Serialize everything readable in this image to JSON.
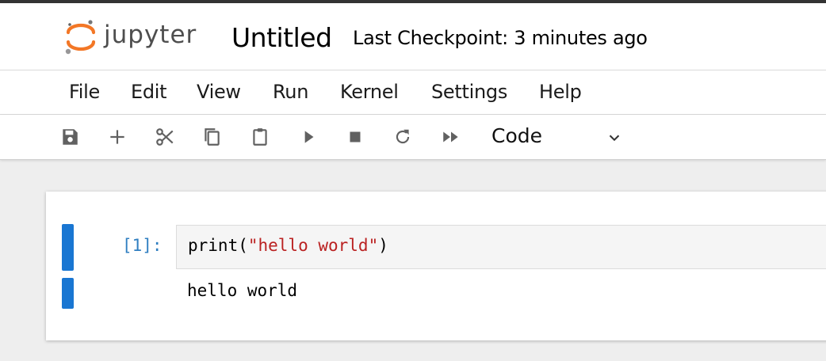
{
  "header": {
    "logo_text": "jupyter",
    "notebook_title": "Untitled",
    "checkpoint": "Last Checkpoint: 3 minutes ago"
  },
  "menu": [
    "File",
    "Edit",
    "View",
    "Run",
    "Kernel",
    "Settings",
    "Help"
  ],
  "toolbar": {
    "buttons": [
      "save-icon",
      "add-cell-icon",
      "cut-icon",
      "copy-icon",
      "paste-icon",
      "run-icon",
      "stop-icon",
      "restart-icon",
      "fast-forward-icon"
    ],
    "cell_type": "Code"
  },
  "cell": {
    "prompt": "[1]:",
    "code_fn": "print(",
    "code_str": "\"hello world\"",
    "code_close": ")",
    "output": "hello world"
  },
  "colors": {
    "accent": "#1976d2",
    "prompt": "#307fc1",
    "string": "#ba2121",
    "logo_orange": "#f37726"
  }
}
